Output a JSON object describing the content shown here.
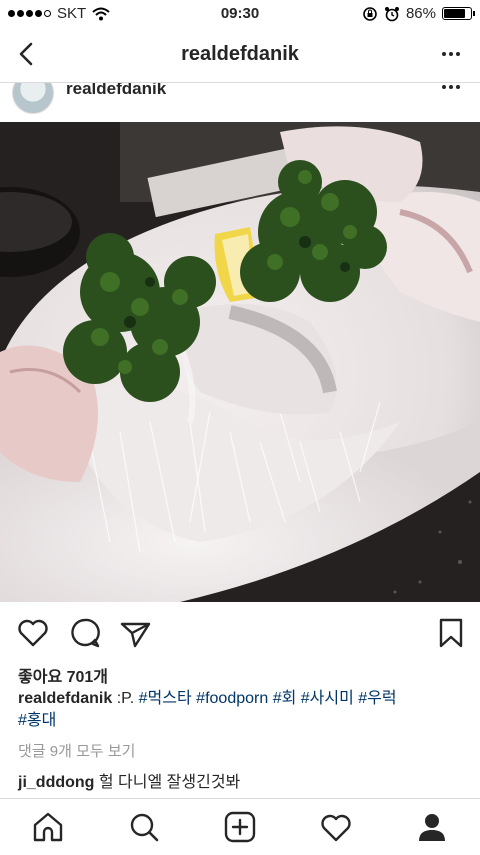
{
  "status_bar": {
    "carrier": "SKT",
    "time": "09:30",
    "battery": "86%",
    "battery_level": 0.86
  },
  "nav": {
    "title": "realdefdanik",
    "back_icon": "chevron-left-icon",
    "more_icon": "more-dots-icon"
  },
  "post": {
    "username": "realdefdanik",
    "likes": "좋아요 701개",
    "caption_user": "realdefdanik",
    "caption_text": " :P. ",
    "hashtags": [
      "#먹스타",
      "#foodporn",
      "#회",
      "#사시미",
      "#우럭",
      "#홍대"
    ],
    "view_comments": "댓글 9개 모두 보기",
    "comment_user": "ji_dddong",
    "comment_text": " 헐 다니엘 잘생긴것봐"
  },
  "actions": {
    "like_icon": "heart-icon",
    "comment_icon": "comment-icon",
    "share_icon": "send-icon",
    "save_icon": "bookmark-icon"
  },
  "tabs": [
    "home-icon",
    "search-icon",
    "add-icon",
    "activity-heart-icon",
    "profile-icon"
  ]
}
